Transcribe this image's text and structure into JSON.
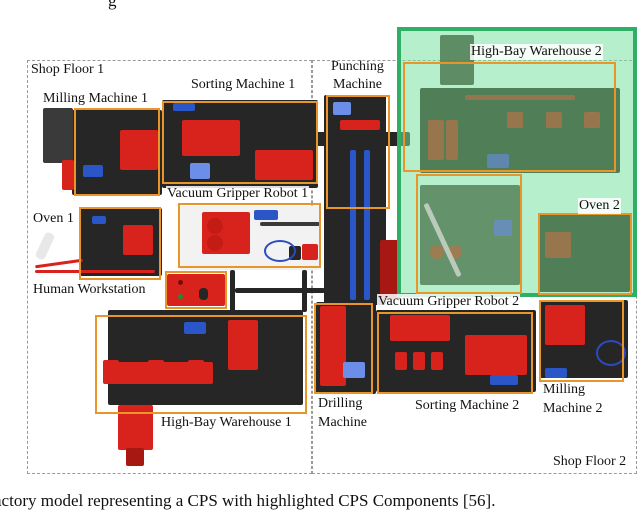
{
  "figure": {
    "top_cut_text": "F  g",
    "caption": "actory model representing a CPS with highlighted CPS Components [56].",
    "shop_floors": [
      {
        "id": "shop-floor-1",
        "label": "Shop Floor 1"
      },
      {
        "id": "shop-floor-2",
        "label": "Shop Floor 2"
      }
    ],
    "components": {
      "milling_machine_1": "Milling Machine 1",
      "sorting_machine_1": "Sorting Machine 1",
      "punching_machine": "Punching\nMachine",
      "punching_machine_l1": "Punching",
      "punching_machine_l2": "Machine",
      "vacuum_gripper_robot_1": "Vacuum Gripper Robot 1",
      "oven_1": "Oven 1",
      "human_workstation": "Human Workstation",
      "high_bay_warehouse_1": "High-Bay Warehouse 1",
      "drilling_machine_l1": "Drilling",
      "drilling_machine_l2": "Machine",
      "vacuum_gripper_robot_2": "Vacuum Gripper Robot 2",
      "sorting_machine_2": "Sorting Machine 2",
      "milling_machine_2_l1": "Milling",
      "milling_machine_2_l2": "Machine 2",
      "high_bay_warehouse_2": "High-Bay Warehouse 2",
      "oven_2": "Oven 2"
    },
    "colors": {
      "component_box": "#e8962a",
      "highlight_zone_fill": "#78e1a0",
      "highlight_zone_border": "#2fae66",
      "shop_floor_border": "#9a9a9a"
    }
  }
}
